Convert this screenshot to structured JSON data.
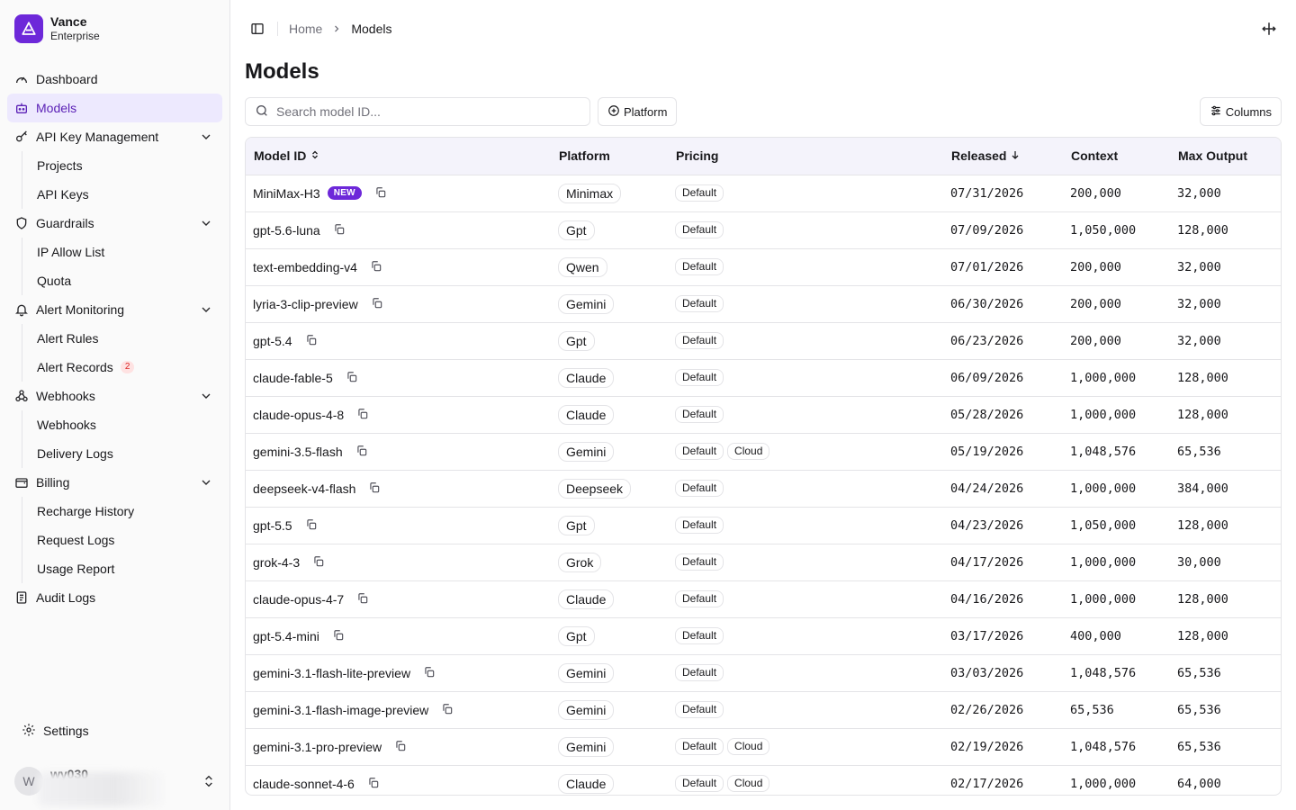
{
  "brand": {
    "name": "Vance",
    "sub": "Enterprise"
  },
  "nav": {
    "dashboard": "Dashboard",
    "models": "Models",
    "api_key_management": "API Key Management",
    "projects": "Projects",
    "api_keys": "API Keys",
    "guardrails": "Guardrails",
    "ip_allow_list": "IP Allow List",
    "quota": "Quota",
    "alert_monitoring": "Alert Monitoring",
    "alert_rules": "Alert Rules",
    "alert_records": "Alert Records",
    "alert_records_count": "2",
    "webhooks": "Webhooks",
    "webhooks_sub": "Webhooks",
    "delivery_logs": "Delivery Logs",
    "billing": "Billing",
    "recharge_history": "Recharge History",
    "request_logs": "Request Logs",
    "usage_report": "Usage Report",
    "audit_logs": "Audit Logs",
    "settings": "Settings"
  },
  "user": {
    "initial": "W",
    "name": "wy030"
  },
  "breadcrumb": {
    "home": "Home",
    "current": "Models"
  },
  "page_title": "Models",
  "toolbar": {
    "search_placeholder": "Search model ID...",
    "platform_label": "Platform",
    "columns_label": "Columns"
  },
  "table": {
    "headers": {
      "model_id": "Model ID",
      "platform": "Platform",
      "pricing": "Pricing",
      "released": "Released",
      "context": "Context",
      "max_output": "Max Output"
    },
    "new_label": "NEW",
    "rows": [
      {
        "id": "MiniMax-H3",
        "is_new": true,
        "platform": "Minimax",
        "pricing": [
          "Default"
        ],
        "released": "07/31/2026",
        "context": "200,000",
        "max_output": "32,000"
      },
      {
        "id": "gpt-5.6-luna",
        "platform": "Gpt",
        "pricing": [
          "Default"
        ],
        "released": "07/09/2026",
        "context": "1,050,000",
        "max_output": "128,000"
      },
      {
        "id": "text-embedding-v4",
        "platform": "Qwen",
        "pricing": [
          "Default"
        ],
        "released": "07/01/2026",
        "context": "200,000",
        "max_output": "32,000"
      },
      {
        "id": "lyria-3-clip-preview",
        "platform": "Gemini",
        "pricing": [
          "Default"
        ],
        "released": "06/30/2026",
        "context": "200,000",
        "max_output": "32,000"
      },
      {
        "id": "gpt-5.4",
        "platform": "Gpt",
        "pricing": [
          "Default"
        ],
        "released": "06/23/2026",
        "context": "200,000",
        "max_output": "32,000"
      },
      {
        "id": "claude-fable-5",
        "platform": "Claude",
        "pricing": [
          "Default"
        ],
        "released": "06/09/2026",
        "context": "1,000,000",
        "max_output": "128,000"
      },
      {
        "id": "claude-opus-4-8",
        "platform": "Claude",
        "pricing": [
          "Default"
        ],
        "released": "05/28/2026",
        "context": "1,000,000",
        "max_output": "128,000"
      },
      {
        "id": "gemini-3.5-flash",
        "platform": "Gemini",
        "pricing": [
          "Default",
          "Cloud"
        ],
        "released": "05/19/2026",
        "context": "1,048,576",
        "max_output": "65,536"
      },
      {
        "id": "deepseek-v4-flash",
        "platform": "Deepseek",
        "pricing": [
          "Default"
        ],
        "released": "04/24/2026",
        "context": "1,000,000",
        "max_output": "384,000"
      },
      {
        "id": "gpt-5.5",
        "platform": "Gpt",
        "pricing": [
          "Default"
        ],
        "released": "04/23/2026",
        "context": "1,050,000",
        "max_output": "128,000"
      },
      {
        "id": "grok-4-3",
        "platform": "Grok",
        "pricing": [
          "Default"
        ],
        "released": "04/17/2026",
        "context": "1,000,000",
        "max_output": "30,000"
      },
      {
        "id": "claude-opus-4-7",
        "platform": "Claude",
        "pricing": [
          "Default"
        ],
        "released": "04/16/2026",
        "context": "1,000,000",
        "max_output": "128,000"
      },
      {
        "id": "gpt-5.4-mini",
        "platform": "Gpt",
        "pricing": [
          "Default"
        ],
        "released": "03/17/2026",
        "context": "400,000",
        "max_output": "128,000"
      },
      {
        "id": "gemini-3.1-flash-lite-preview",
        "platform": "Gemini",
        "pricing": [
          "Default"
        ],
        "released": "03/03/2026",
        "context": "1,048,576",
        "max_output": "65,536"
      },
      {
        "id": "gemini-3.1-flash-image-preview",
        "platform": "Gemini",
        "pricing": [
          "Default"
        ],
        "released": "02/26/2026",
        "context": "65,536",
        "max_output": "65,536"
      },
      {
        "id": "gemini-3.1-pro-preview",
        "platform": "Gemini",
        "pricing": [
          "Default",
          "Cloud"
        ],
        "released": "02/19/2026",
        "context": "1,048,576",
        "max_output": "65,536"
      },
      {
        "id": "claude-sonnet-4-6",
        "platform": "Claude",
        "pricing": [
          "Default",
          "Cloud"
        ],
        "released": "02/17/2026",
        "context": "1,000,000",
        "max_output": "64,000"
      }
    ]
  },
  "colors": {
    "accent": "#6d28d9",
    "active_bg": "#ede9fe",
    "header_bg": "#f4f3fb"
  }
}
